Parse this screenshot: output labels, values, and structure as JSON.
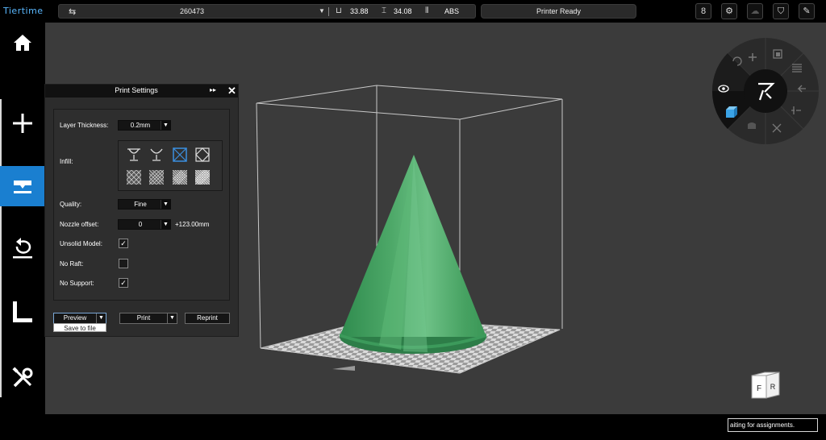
{
  "app": {
    "logo": "Tiertime"
  },
  "topbar": {
    "serial": "260473",
    "nozzle_temp": "33.88",
    "bed_temp": "34.08",
    "material": "ABS",
    "status": "Printer Ready",
    "icons": [
      "usb-icon",
      "printer-status-icon",
      "settings-gear-icon",
      "cloud-icon",
      "shirt-icon",
      "edit-icon"
    ]
  },
  "sidebar": {
    "items": [
      {
        "name": "home",
        "icon": "home-icon",
        "glyph": "⌂"
      },
      {
        "name": "add",
        "icon": "plus-icon",
        "glyph": "+"
      },
      {
        "name": "print",
        "icon": "print-icon",
        "glyph": ""
      },
      {
        "name": "maintenance",
        "icon": "refresh-icon",
        "glyph": "↺"
      },
      {
        "name": "calibrate",
        "icon": "ruler-icon",
        "glyph": ""
      },
      {
        "name": "tools",
        "icon": "tools-icon",
        "glyph": "✕"
      }
    ]
  },
  "print_settings": {
    "title": "Print Settings",
    "layer_thickness_label": "Layer Thickness:",
    "layer_thickness_value": "0.2mm",
    "infill_label": "Infill:",
    "quality_label": "Quality:",
    "quality_value": "Fine",
    "nozzle_offset_label": "Nozzle offset:",
    "nozzle_offset_value": "0",
    "nozzle_height": "+123.00mm",
    "unsolid_label": "Unsolid Model:",
    "unsolid_checked": true,
    "no_raft_label": "No Raft:",
    "no_raft_checked": false,
    "no_support_label": "No Support:",
    "no_support_checked": true,
    "preview_label": "Preview",
    "save_to_file_label": "Save to file",
    "print_label": "Print",
    "reprint_label": "Reprint",
    "check_glyph": "✓",
    "dropdown_glyph": "▼"
  },
  "view_cube": {
    "front": "F",
    "right": "R"
  },
  "statusbar": {
    "message": "aiting for assignments."
  },
  "colors": {
    "accent": "#1a7fd0",
    "model": "#4caf6a",
    "viewport": "#3b3b3b"
  }
}
